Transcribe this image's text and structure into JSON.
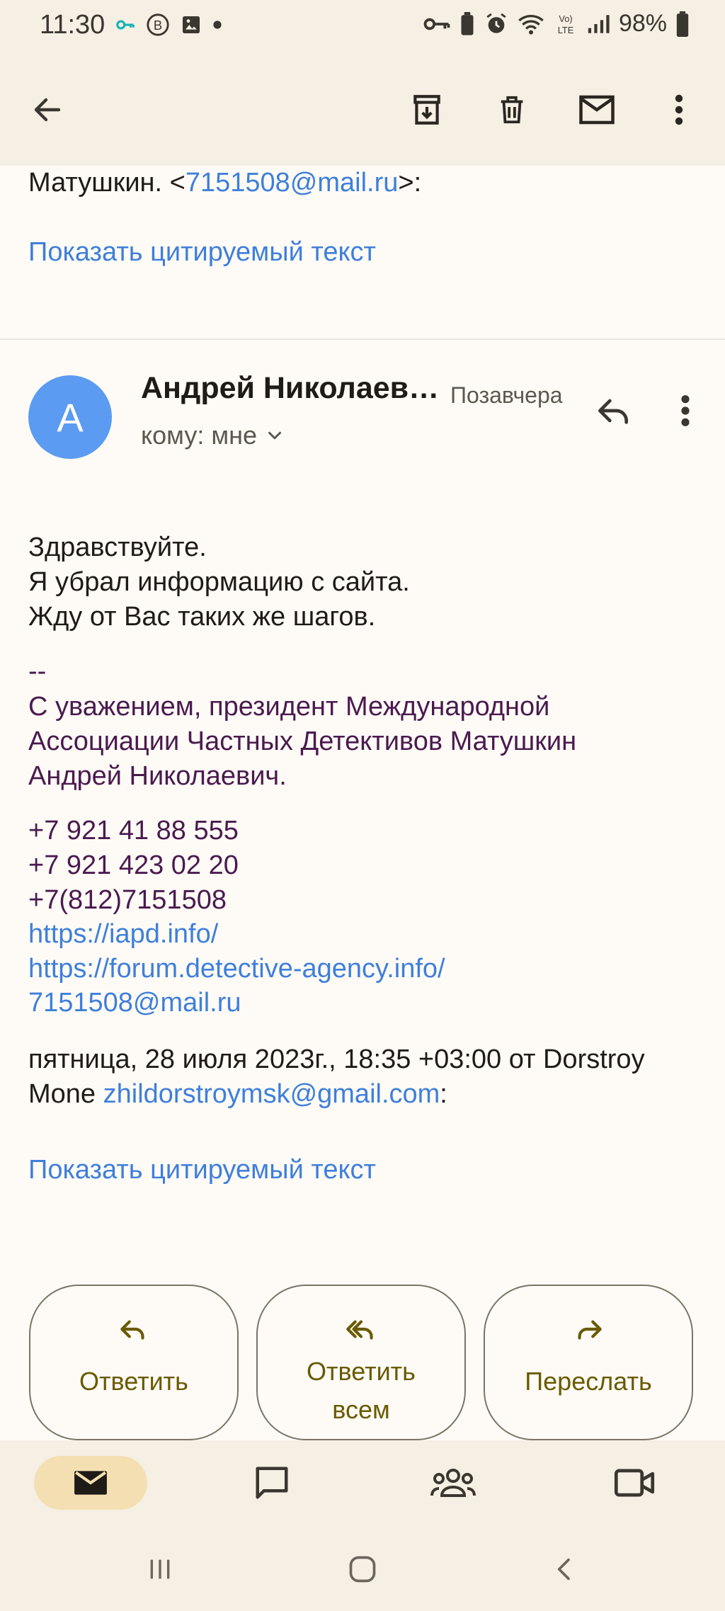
{
  "status_bar": {
    "time": "11:30",
    "battery": "98%"
  },
  "top_bar": {
    "back_icon": "arrow-left-icon",
    "archive_icon": "archive-icon",
    "delete_icon": "trash-icon",
    "mark_unread_icon": "mail-icon",
    "more_icon": "more-vert-icon"
  },
  "previous_message": {
    "sender_prefix": "Матушкин. <",
    "sender_email": "7151508@mail.ru",
    "sender_suffix": ">:",
    "show_quoted": "Показать цитируемый текст"
  },
  "message": {
    "avatar_letter": "А",
    "sender_name": "Андрей Николаев…",
    "date": "Позавчера",
    "recipients": "кому: мне",
    "body": [
      "Здравствуйте.",
      "Я убрал информацию с сайта.",
      "Жду от Вас таких же шагов."
    ],
    "signature": {
      "separator": "--",
      "lines": [
        "С уважением, президент Международной",
        "Ассоциации Частных Детективов Матушкин",
        "Андрей Николаевич."
      ],
      "phones": [
        "+7 921 41 88 555",
        "+7 921 423 02 20",
        "+7(812)7151508"
      ],
      "links": [
        "https://iapd.info/",
        "https://forum.detective-agency.info/",
        "7151508@mail.ru"
      ]
    },
    "quote_header_line1": "пятница, 28 июля 2023г., 18:35 +03:00 от Dorstroy",
    "quote_header_line2_prefix": "Mone ",
    "quote_header_email": "zhildorstroymsk@gmail.com",
    "quote_header_suffix": ":",
    "show_quoted": "Показать цитируемый текст"
  },
  "actions": {
    "reply": "Ответить",
    "reply_all_line1": "Ответить",
    "reply_all_line2": "всем",
    "forward": "Переслать"
  },
  "bottom_nav": {
    "items": [
      {
        "icon": "mail-icon",
        "selected": true
      },
      {
        "icon": "chat-icon",
        "selected": false
      },
      {
        "icon": "spaces-icon",
        "selected": false
      },
      {
        "icon": "meet-icon",
        "selected": false
      }
    ]
  },
  "colors": {
    "link": "#3f7fdb",
    "signature": "#4b1a4f",
    "action_text": "#6a5a00",
    "avatar": "#5b9bf2",
    "selected_pill": "#f4dfb2"
  }
}
